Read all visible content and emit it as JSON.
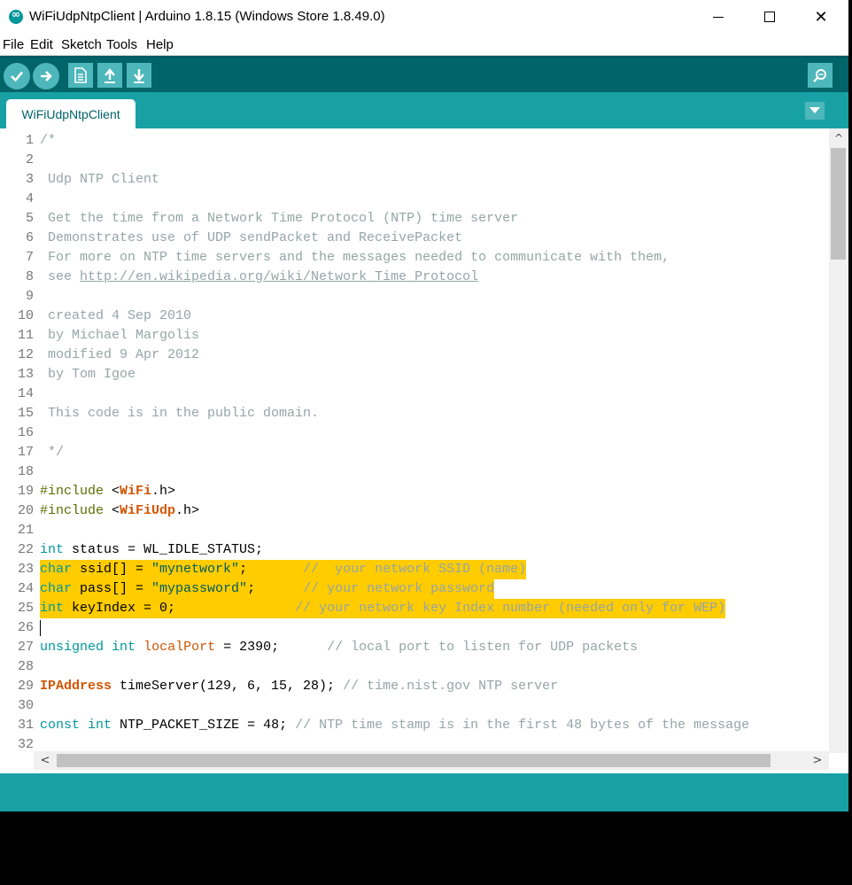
{
  "window": {
    "title": "WiFiUdpNtpClient | Arduino 1.8.15 (Windows Store 1.8.49.0)",
    "controls": {
      "minimize": "—",
      "maximize": "☐",
      "close": "✕"
    }
  },
  "menubar": {
    "items": [
      "File",
      "Edit",
      "Sketch",
      "Tools",
      "Help"
    ]
  },
  "toolbar": {
    "buttons": [
      "verify-icon",
      "upload-icon",
      "new-icon",
      "open-icon",
      "save-icon"
    ],
    "right_button": "serial-monitor-icon"
  },
  "tabs": [
    {
      "label": "WiFiUdpNtpClient",
      "active": true
    }
  ],
  "colors": {
    "teal_dark": "#006468",
    "teal": "#17a1a5",
    "highlight": "#ffcc00"
  },
  "editor": {
    "highlighted_lines": [
      23,
      24,
      25
    ],
    "caret_line": 26,
    "lines": [
      {
        "n": "1",
        "segs": [
          [
            "c-cm",
            "/*"
          ]
        ]
      },
      {
        "n": "2",
        "segs": []
      },
      {
        "n": "3",
        "segs": [
          [
            "c-cm",
            " Udp NTP Client"
          ]
        ]
      },
      {
        "n": "4",
        "segs": []
      },
      {
        "n": "5",
        "segs": [
          [
            "c-cm",
            " Get the time from a Network Time Protocol (NTP) time server"
          ]
        ]
      },
      {
        "n": "6",
        "segs": [
          [
            "c-cm",
            " Demonstrates use of UDP sendPacket and ReceivePacket"
          ]
        ]
      },
      {
        "n": "7",
        "segs": [
          [
            "c-cm",
            " For more on NTP time servers and the messages needed to communicate with them,"
          ]
        ]
      },
      {
        "n": "8",
        "segs": [
          [
            "c-cm",
            " see "
          ],
          [
            "c-cm c-url",
            "http://en.wikipedia.org/wiki/Network_Time_Protocol"
          ]
        ]
      },
      {
        "n": "9",
        "segs": []
      },
      {
        "n": "10",
        "segs": [
          [
            "c-cm",
            " created 4 Sep 2010"
          ]
        ]
      },
      {
        "n": "11",
        "segs": [
          [
            "c-cm",
            " by Michael Margolis"
          ]
        ]
      },
      {
        "n": "12",
        "segs": [
          [
            "c-cm",
            " modified 9 Apr 2012"
          ]
        ]
      },
      {
        "n": "13",
        "segs": [
          [
            "c-cm",
            " by Tom Igoe"
          ]
        ]
      },
      {
        "n": "14",
        "segs": []
      },
      {
        "n": "15",
        "segs": [
          [
            "c-cm",
            " This code is in the public domain."
          ]
        ]
      },
      {
        "n": "16",
        "segs": []
      },
      {
        "n": "17",
        "segs": [
          [
            "c-cm",
            " */"
          ]
        ]
      },
      {
        "n": "18",
        "segs": []
      },
      {
        "n": "19",
        "segs": [
          [
            "c-pp",
            "#include"
          ],
          [
            "",
            " <"
          ],
          [
            "c-cls",
            "WiFi"
          ],
          [
            "",
            ".h>"
          ]
        ]
      },
      {
        "n": "20",
        "segs": [
          [
            "c-pp",
            "#include"
          ],
          [
            "",
            " <"
          ],
          [
            "c-cls",
            "WiFiUdp"
          ],
          [
            "",
            ".h>"
          ]
        ]
      },
      {
        "n": "21",
        "segs": []
      },
      {
        "n": "22",
        "segs": [
          [
            "c-kw",
            "int"
          ],
          [
            "",
            " status = WL_IDLE_STATUS;"
          ]
        ]
      },
      {
        "n": "23",
        "segs": [
          [
            "c-kw",
            "char"
          ],
          [
            "",
            " ssid[] = "
          ],
          [
            "c-str",
            "\"mynetwork\""
          ],
          [
            "",
            ";       "
          ],
          [
            "c-cm",
            "//  your network SSID (name)"
          ]
        ]
      },
      {
        "n": "24",
        "segs": [
          [
            "c-kw",
            "char"
          ],
          [
            "",
            " pass[] = "
          ],
          [
            "c-str",
            "\"mypassword\""
          ],
          [
            "",
            ";      "
          ],
          [
            "c-cm",
            "// your network password"
          ]
        ]
      },
      {
        "n": "25",
        "segs": [
          [
            "c-kw",
            "int"
          ],
          [
            "",
            " keyIndex = 0;               "
          ],
          [
            "c-cm",
            "// your network key Index number (needed only for WEP)"
          ]
        ]
      },
      {
        "n": "26",
        "segs": []
      },
      {
        "n": "27",
        "segs": [
          [
            "c-kw",
            "unsigned"
          ],
          [
            "",
            " "
          ],
          [
            "c-kw",
            "int"
          ],
          [
            "",
            " "
          ],
          [
            "c-kw2",
            "localPort"
          ],
          [
            "",
            " = 2390;      "
          ],
          [
            "c-cm",
            "// local port to listen for UDP packets"
          ]
        ]
      },
      {
        "n": "28",
        "segs": []
      },
      {
        "n": "29",
        "segs": [
          [
            "c-cls",
            "IPAddress"
          ],
          [
            "",
            " timeServer(129, 6, 15, 28); "
          ],
          [
            "c-cm",
            "// time.nist.gov NTP server"
          ]
        ]
      },
      {
        "n": "30",
        "segs": []
      },
      {
        "n": "31",
        "segs": [
          [
            "c-kw",
            "const"
          ],
          [
            "",
            " "
          ],
          [
            "c-kw",
            "int"
          ],
          [
            "",
            " NTP_PACKET_SIZE = 48; "
          ],
          [
            "c-cm",
            "// NTP time stamp is in the first 48 bytes of the message"
          ]
        ]
      },
      {
        "n": "32",
        "segs": []
      }
    ]
  },
  "scrollbars": {
    "vertical": {
      "up_arrow": "^"
    },
    "horizontal": {
      "left_arrow": "<",
      "right_arrow": ">"
    }
  }
}
